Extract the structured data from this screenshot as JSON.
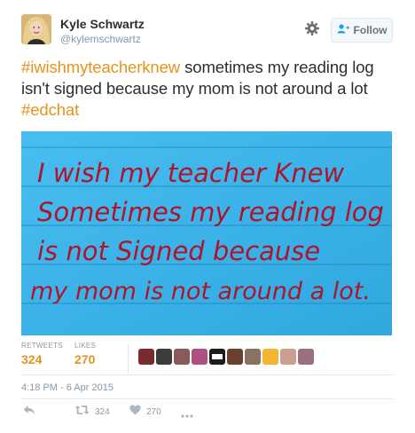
{
  "user": {
    "name": "Kyle Schwartz",
    "handle": "@kylemschwartz"
  },
  "follow_button": {
    "label": "Follow"
  },
  "tweet": {
    "hashtag1": "#iwishmyteacherknew",
    "body": " sometimes my reading log isn't signed because my mom is not around a lot ",
    "hashtag2": "#edchat"
  },
  "photo_note": {
    "lines": [
      "I wish my teacher Knew",
      "Sometimes my reading log",
      "is not Signed because",
      "my mom is not around a lot."
    ]
  },
  "stats": {
    "retweets_label": "RETWEETS",
    "retweets_value": "324",
    "likes_label": "LIKES",
    "likes_value": "270"
  },
  "likers": {
    "colors": [
      "#7a2b2f",
      "#3c3c3c",
      "#8a5a5a",
      "#b05080",
      "#1c1c1c",
      "#6b4030",
      "#8a7260",
      "#f2b632",
      "#c9a090",
      "#9a7080"
    ],
    "badge_text": "BLACK LIVES MATTER"
  },
  "timestamp": "4:18 PM - 6 Apr 2015",
  "actions": {
    "retweet_count": "324",
    "like_count": "270"
  },
  "colors": {
    "accent": "#e6931e",
    "card_blue": "#3cb4ea",
    "ink_red": "#b0142a"
  }
}
